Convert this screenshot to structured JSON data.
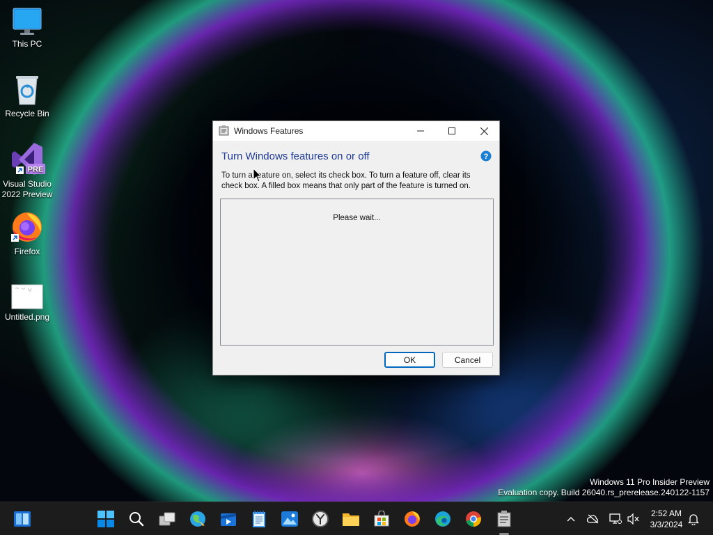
{
  "desktop": {
    "icons": [
      {
        "label": "This PC",
        "icon": "monitor-icon"
      },
      {
        "label": "Recycle Bin",
        "icon": "recycle-bin-icon"
      },
      {
        "label": "Visual Studio 2022 Preview",
        "line1": "Visual Studio",
        "line2": "2022 Preview",
        "badge": "PRE",
        "icon": "visual-studio-icon"
      },
      {
        "label": "Firefox",
        "icon": "firefox-icon"
      },
      {
        "label": "Untitled.png",
        "icon": "image-file-icon"
      }
    ]
  },
  "dialog": {
    "title": "Windows Features",
    "heading": "Turn Windows features on or off",
    "description": "To turn a feature on, select its check box. To turn a feature off, clear its check box. A filled box means that only part of the feature is turned on.",
    "status": "Please wait...",
    "ok_label": "OK",
    "cancel_label": "Cancel",
    "heading_color": "#1e3c96"
  },
  "watermark": {
    "line1": "Windows 11 Pro Insider Preview",
    "line2": "Evaluation copy. Build 26040.rs_prerelease.240122-1157"
  },
  "taskbar": {
    "apps": [
      "widgets-icon",
      "start-icon",
      "search-icon",
      "task-view-icon",
      "globe-app-icon",
      "media-app-icon",
      "notepad-icon",
      "photos-icon",
      "clock-app-icon",
      "file-explorer-icon",
      "store-icon",
      "firefox-icon",
      "edge-icon",
      "chrome-icon",
      "windows-features-icon"
    ],
    "tray": [
      "chevron-up-icon",
      "onedrive-offline-icon",
      "network-icon",
      "volume-muted-icon",
      "notifications-icon"
    ],
    "time": "2:52 AM",
    "date": "3/3/2024",
    "accent": "#0078d4"
  }
}
